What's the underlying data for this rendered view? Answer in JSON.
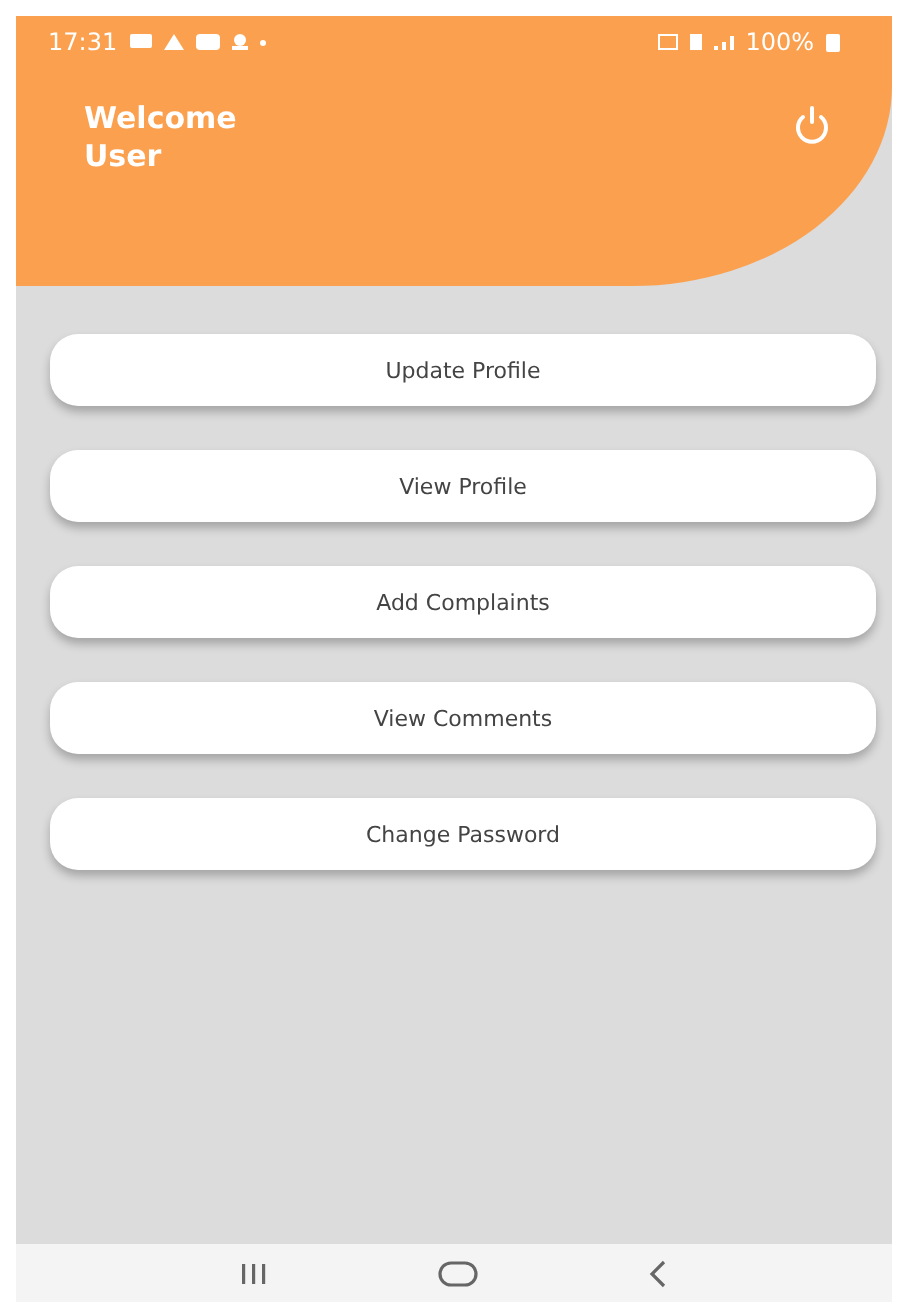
{
  "status_bar": {
    "time": "17:31",
    "battery": "100%"
  },
  "header": {
    "greeting": "Welcome",
    "name": "User"
  },
  "menu": [
    {
      "label": "Update Profile"
    },
    {
      "label": "View Profile"
    },
    {
      "label": "Add Complaints"
    },
    {
      "label": "View Comments"
    },
    {
      "label": "Change Password"
    }
  ]
}
